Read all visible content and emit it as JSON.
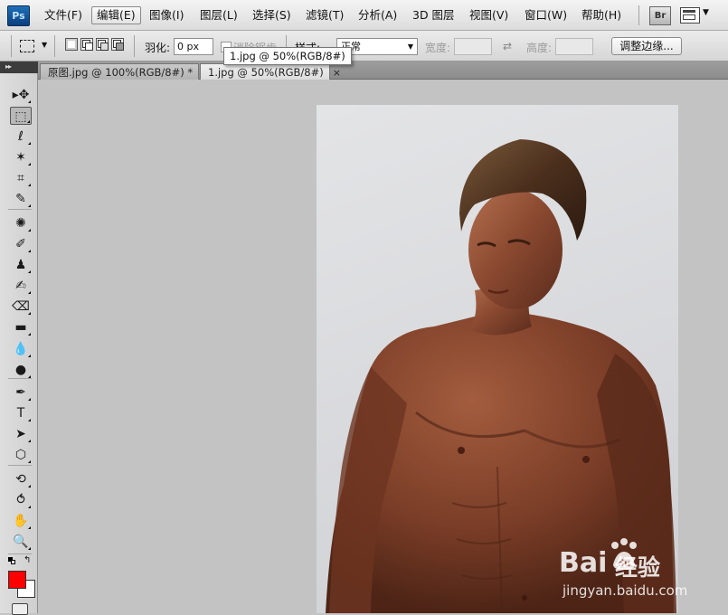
{
  "app": {
    "logo": "Ps"
  },
  "menu": {
    "items": [
      "文件(F)",
      "编辑(E)",
      "图像(I)",
      "图层(L)",
      "选择(S)",
      "滤镜(T)",
      "分析(A)",
      "3D 图层",
      "视图(V)",
      "窗口(W)",
      "帮助(H)"
    ],
    "active_index": 1,
    "bridge_label": "Br"
  },
  "options": {
    "feather_label": "羽化:",
    "feather_value": "0 px",
    "antialias_label": "消除锯齿",
    "style_label": "样式:",
    "style_value": "正常",
    "width_label": "宽度:",
    "height_label": "高度:",
    "refine_edge_label": "调整边缘..."
  },
  "tooltip": {
    "text": "1.jpg @ 50%(RGB/8#)"
  },
  "tabs": [
    {
      "label": "原图.jpg @ 100%(RGB/8#) *",
      "close": "×",
      "active": false
    },
    {
      "label": "1.jpg @ 50%(RGB/8#)",
      "close": "×",
      "active": true
    }
  ],
  "toolbar": {
    "header_glyph": "▸▸",
    "tools": [
      {
        "name": "move-tool",
        "glyph": "▸✥"
      },
      {
        "name": "marquee-tool",
        "glyph": "⬚"
      },
      {
        "name": "lasso-tool",
        "glyph": "ℓ"
      },
      {
        "name": "magic-wand-tool",
        "glyph": "✶"
      },
      {
        "name": "crop-tool",
        "glyph": "⌗"
      },
      {
        "name": "eyedropper-tool",
        "glyph": "✎"
      },
      {
        "name": "spot-healing-tool",
        "glyph": "✺"
      },
      {
        "name": "brush-tool",
        "glyph": "✐"
      },
      {
        "name": "clone-stamp-tool",
        "glyph": "♟"
      },
      {
        "name": "history-brush-tool",
        "glyph": "✍"
      },
      {
        "name": "eraser-tool",
        "glyph": "⌫"
      },
      {
        "name": "gradient-tool",
        "glyph": "▬"
      },
      {
        "name": "blur-tool",
        "glyph": "💧"
      },
      {
        "name": "dodge-tool",
        "glyph": "●"
      },
      {
        "name": "pen-tool",
        "glyph": "✒"
      },
      {
        "name": "type-tool",
        "glyph": "T"
      },
      {
        "name": "path-selection-tool",
        "glyph": "➤"
      },
      {
        "name": "shape-tool",
        "glyph": "⬡"
      },
      {
        "name": "3d-rotate-tool",
        "glyph": "⟲"
      },
      {
        "name": "3d-orbit-tool",
        "glyph": "⥀"
      },
      {
        "name": "hand-tool",
        "glyph": "✋"
      },
      {
        "name": "zoom-tool",
        "glyph": "🔍"
      }
    ],
    "foreground_color": "#ff0000",
    "background_color": "#ffffff"
  },
  "watermark": {
    "brand": "Bai",
    "paw": "du",
    "jingyan": "经验",
    "url": "jingyan.baidu.com"
  },
  "colors": {
    "workspace": "#c3c3c3",
    "canvas_backdrop": "#dadbde",
    "skin": "#8a4a32",
    "hair": "#4a3020"
  }
}
